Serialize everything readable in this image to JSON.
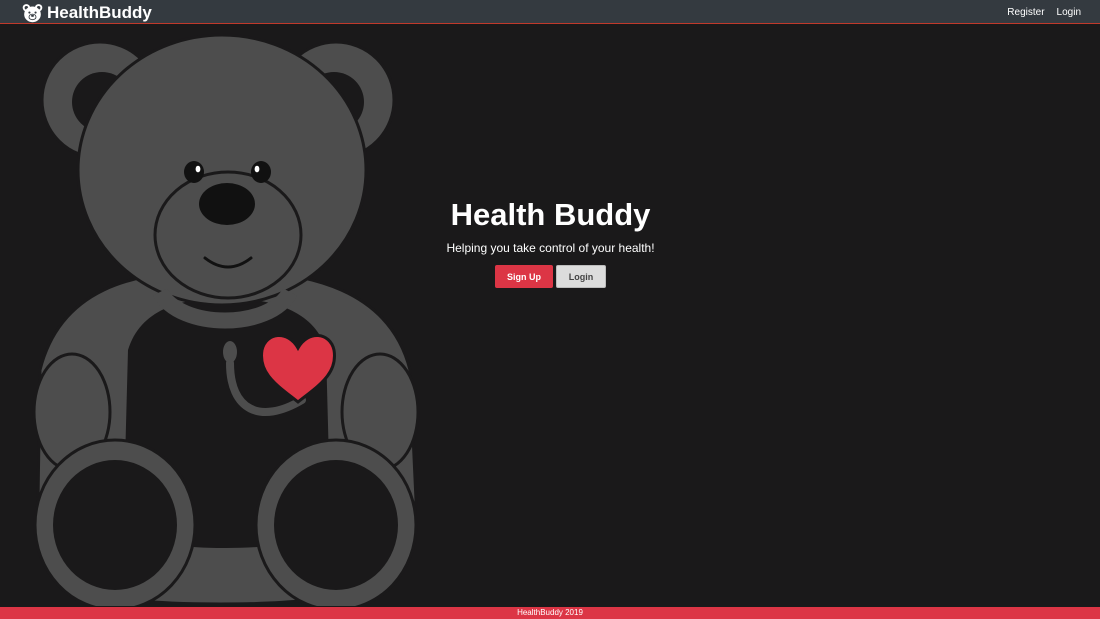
{
  "navbar": {
    "brand": "HealthBuddy",
    "links": [
      "Register",
      "Login"
    ]
  },
  "hero": {
    "title": "Health Buddy",
    "subtitle": "Helping you take control of your health!",
    "signup_label": "Sign Up",
    "login_label": "Login"
  },
  "footer": {
    "text": "HealthBuddy 2019"
  },
  "icons": {
    "brand": "teddy-bear-icon",
    "hero_art": "teddy-bear-illustration",
    "heart": "heart-icon"
  },
  "colors": {
    "background": "#1a191a",
    "navbar": "#343a40",
    "accent": "#dc3545",
    "bear": "#4d4d4d",
    "secondary_button": "#dcdcdc"
  }
}
